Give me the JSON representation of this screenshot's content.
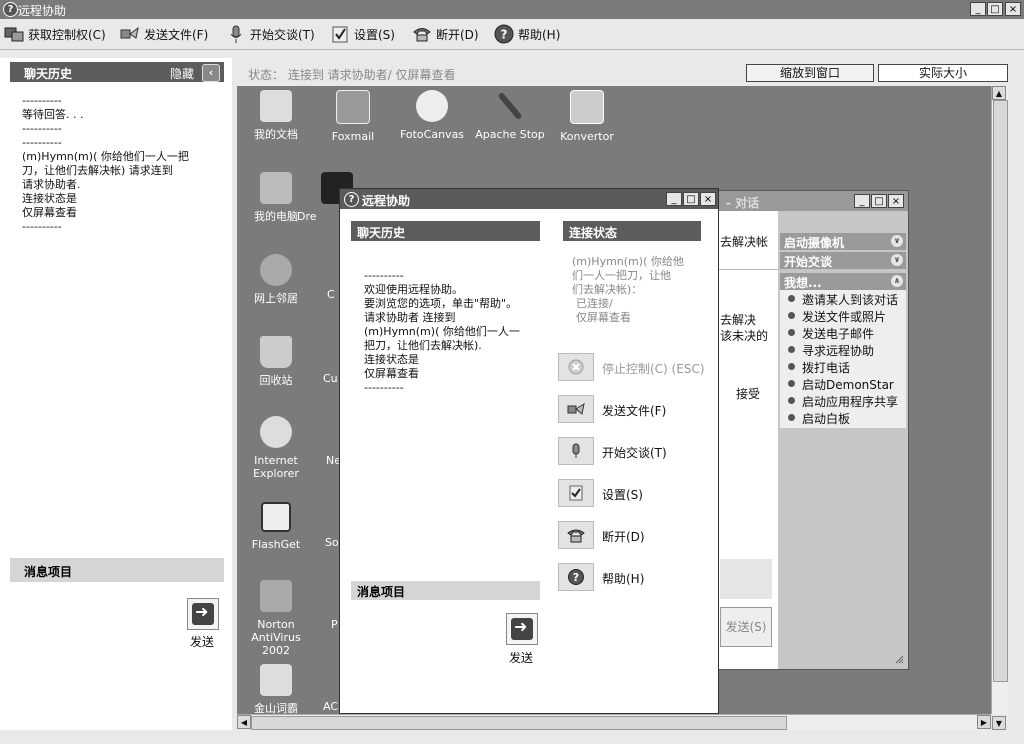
{
  "window": {
    "title": "远程协助",
    "controls": [
      "_",
      "□",
      "×"
    ]
  },
  "toolbar": {
    "items": [
      {
        "label": "获取控制权(C)",
        "icon": "take-control-icon"
      },
      {
        "label": "发送文件(F)",
        "icon": "send-file-icon"
      },
      {
        "label": "开始交谈(T)",
        "icon": "microphone-icon"
      },
      {
        "label": "设置(S)",
        "icon": "settings-icon"
      },
      {
        "label": "断开(D)",
        "icon": "disconnect-phone-icon"
      },
      {
        "label": "帮助(H)",
        "icon": "help-icon"
      }
    ]
  },
  "left_panel": {
    "chat_history_title": "聊天历史",
    "hide_label": "隐藏",
    "chat_lines": [
      "----------",
      "等待回答. . .",
      "----------",
      "----------",
      "(m)Hymn(m)( 你给他们一人一把",
      "刀，让他们去解决帐)  请求连到",
      "请求协助者.",
      "连接状态是",
      "仅屏幕查看",
      "----------"
    ],
    "message_title": "消息项目",
    "send_label": "发送"
  },
  "status_bar": {
    "text": "状态：   连接到  请求协助者/  仅屏幕查看",
    "fit_window": "缩放到窗口",
    "actual_size": "实际大小"
  },
  "desktop": {
    "icons": [
      {
        "label": "我的文档",
        "name": "my-documents-icon"
      },
      {
        "label": "Foxmail",
        "name": "foxmail-icon"
      },
      {
        "label": "FotoCanvas",
        "name": "fotocanvas-icon"
      },
      {
        "label": "Apache Stop",
        "name": "apache-stop-icon"
      },
      {
        "label": "Konvertor",
        "name": "konvertor-icon"
      },
      {
        "label": "我的电脑",
        "name": "my-computer-icon"
      },
      {
        "label": "Dre",
        "name": "dreamweaver-icon"
      },
      {
        "label": "网上邻居",
        "name": "network-places-icon"
      },
      {
        "label": "C",
        "name": "desktop-app-c-icon"
      },
      {
        "label": "回收站",
        "name": "recycle-bin-icon"
      },
      {
        "label": "Cu",
        "name": "desktop-app-cu-icon"
      },
      {
        "label": "Internet Explorer",
        "name": "internet-explorer-icon"
      },
      {
        "label": "Ne",
        "name": "desktop-app-ne-icon"
      },
      {
        "label": "FlashGet",
        "name": "flashget-icon"
      },
      {
        "label": "So",
        "name": "desktop-app-so-icon"
      },
      {
        "label": "Norton AntiVirus 2002",
        "name": "norton-antivirus-icon"
      },
      {
        "label": "P",
        "name": "desktop-app-p-icon"
      },
      {
        "label": "金山词霸",
        "name": "jinshan-ciba-icon"
      },
      {
        "label": "AC",
        "name": "desktop-app-ac-icon"
      }
    ]
  },
  "back_dialog": {
    "title": "- 对话",
    "partial_text": [
      "去解决",
      "该未决的",
      "接受",
      "去解决帐"
    ],
    "send_label": "发送(S)",
    "panes": [
      {
        "title": "启动摄像机"
      },
      {
        "title": "开始交谈"
      },
      {
        "title": "我想..."
      }
    ],
    "tasks": [
      "邀请某人到该对话",
      "发送文件或照片",
      "发送电子邮件",
      "寻求远程协助",
      "拨打电话",
      "启动DemonStar",
      "启动应用程序共享",
      "启动白板"
    ]
  },
  "front_dialog": {
    "title": "远程协助",
    "chat_history_title": "聊天历史",
    "chat_lines": [
      "----------",
      "欢迎使用远程协助。",
      "要浏览您的选项，单击\"帮助\"。",
      "请求协助者 连接到",
      "(m)Hymn(m)( 你给他们一人一",
      "把刀，让他们去解决帐).",
      "连接状态是",
      "仅屏幕查看",
      "----------"
    ],
    "connection_title": "连接状态",
    "connection_lines": [
      "(m)Hymn(m)( 你给他",
      "们一人一把刀，让他",
      "们去解决帐)：",
      "已连接/",
      "仅屏幕查看"
    ],
    "buttons": [
      {
        "label": "停止控制(C) (ESC)",
        "disabled": true
      },
      {
        "label": "发送文件(F)"
      },
      {
        "label": "开始交谈(T)"
      },
      {
        "label": "设置(S)"
      },
      {
        "label": "断开(D)"
      },
      {
        "label": "帮助(H)"
      }
    ],
    "message_title": "消息项目",
    "send_label": "发送"
  }
}
